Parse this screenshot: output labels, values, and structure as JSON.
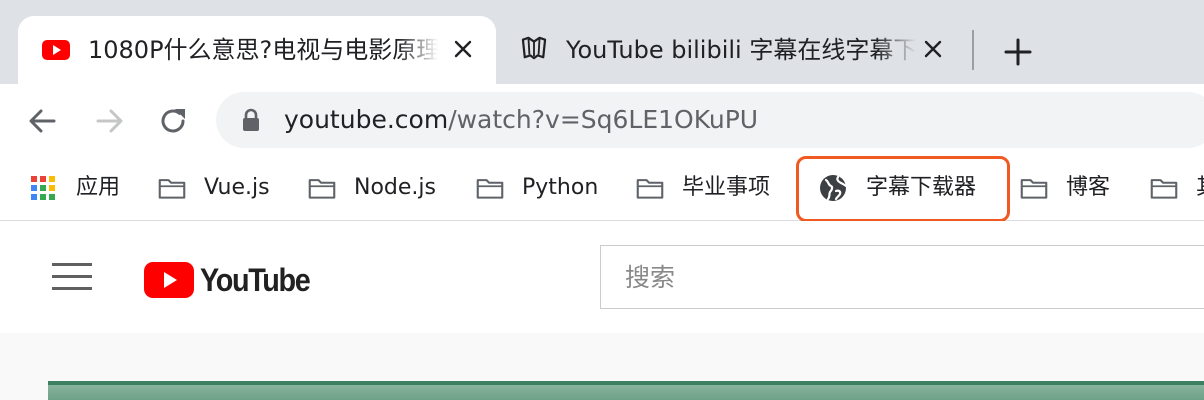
{
  "tabs": [
    {
      "title": "1080P什么意思?电视与电影原理",
      "favicon": "youtube-icon",
      "active": true
    },
    {
      "title": "YouTube bilibili 字幕在线字幕下载",
      "favicon": "book-icon",
      "active": false
    }
  ],
  "toolbar": {
    "url_host": "youtube.com",
    "url_path": "/watch?v=Sq6LE1OKuPU"
  },
  "bookmarks": [
    {
      "label": "应用",
      "icon": "apps-grid-icon"
    },
    {
      "label": "Vue.js",
      "icon": "folder-icon"
    },
    {
      "label": "Node.js",
      "icon": "folder-icon"
    },
    {
      "label": "Python",
      "icon": "folder-icon"
    },
    {
      "label": "毕业事项",
      "icon": "folder-icon"
    },
    {
      "label": "字幕下载器",
      "icon": "globe-icon"
    },
    {
      "label": "博客",
      "icon": "folder-icon"
    },
    {
      "label": "其",
      "icon": "folder-icon"
    }
  ],
  "youtube": {
    "logo_text": "YouTube",
    "search_placeholder": "搜索"
  },
  "colors": {
    "youtube_red": "#ff0000",
    "highlight": "#f05a22",
    "tabstrip": "#dee1e6"
  }
}
